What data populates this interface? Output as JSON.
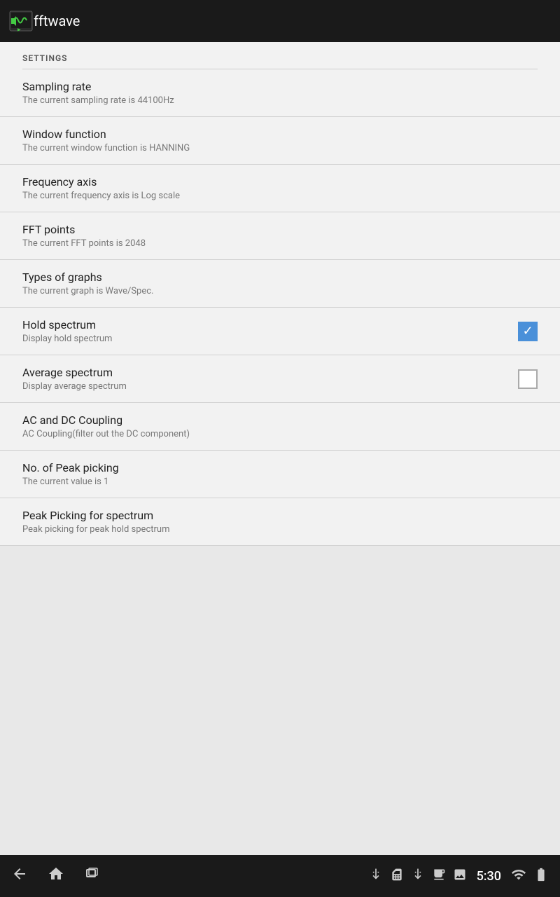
{
  "app": {
    "title": "fftwave"
  },
  "settings_header": "SETTINGS",
  "settings": [
    {
      "id": "sampling-rate",
      "title": "Sampling rate",
      "subtitle": "The current sampling rate is 44100Hz",
      "has_checkbox": false
    },
    {
      "id": "window-function",
      "title": "Window function",
      "subtitle": "The current window function is HANNING",
      "has_checkbox": false
    },
    {
      "id": "frequency-axis",
      "title": "Frequency axis",
      "subtitle": "The current frequency axis is Log scale",
      "has_checkbox": false
    },
    {
      "id": "fft-points",
      "title": "FFT points",
      "subtitle": "The current FFT points is 2048",
      "has_checkbox": false
    },
    {
      "id": "types-of-graphs",
      "title": "Types of graphs",
      "subtitle": "The current graph is Wave/Spec.",
      "has_checkbox": false
    },
    {
      "id": "hold-spectrum",
      "title": "Hold spectrum",
      "subtitle": "Display hold spectrum",
      "has_checkbox": true,
      "checked": true
    },
    {
      "id": "average-spectrum",
      "title": "Average spectrum",
      "subtitle": "Display average spectrum",
      "has_checkbox": true,
      "checked": false
    },
    {
      "id": "ac-dc-coupling",
      "title": "AC and DC Coupling",
      "subtitle": "AC Coupling(filter out the DC component)",
      "has_checkbox": false
    },
    {
      "id": "no-peak-picking",
      "title": "No. of Peak picking",
      "subtitle": "The current value is 1",
      "has_checkbox": false
    },
    {
      "id": "peak-picking-spectrum",
      "title": "Peak Picking for spectrum",
      "subtitle": "Peak picking for peak hold spectrum",
      "has_checkbox": false
    }
  ],
  "status_bar": {
    "time": "5:30",
    "icons": [
      "usb",
      "sim",
      "usb2",
      "news",
      "image",
      "wifi",
      "battery"
    ]
  }
}
